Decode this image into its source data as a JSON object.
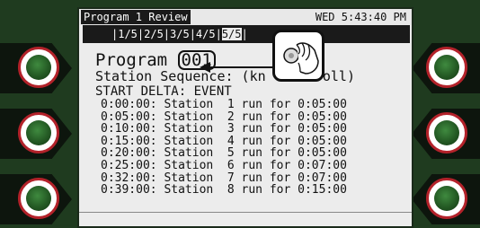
{
  "screen": {
    "title": "Program 1 Review",
    "datetime": "WED 5:43:40 PM",
    "tabs": [
      "|1/5|2/5|3/5|4/5|",
      "5/5",
      "|"
    ],
    "program_label": "Program ",
    "program_value": "001",
    "sequence_text": "Station Sequence: (kn    scroll)",
    "start_delta": "START DELTA: EVENT",
    "rows": [
      "0:00:00: Station  1 run for 0:05:00",
      "0:05:00: Station  2 run for 0:05:00",
      "0:10:00: Station  3 run for 0:05:00",
      "0:15:00: Station  4 run for 0:05:00",
      "0:20:00: Station  5 run for 0:05:00",
      "0:25:00: Station  6 run for 0:07:00",
      "0:32:00: Station  7 run for 0:07:00",
      "0:39:00: Station  8 run for 0:15:00"
    ]
  },
  "icons": {
    "knob_callout": "hand-turning-knob-icon",
    "arrow": "arrow-left-icon"
  },
  "colors": {
    "bezel": "#1f3b1f",
    "button_ring": "#b3222a",
    "button_cap": "#2e6b2e",
    "screen_bg": "#ececec"
  }
}
